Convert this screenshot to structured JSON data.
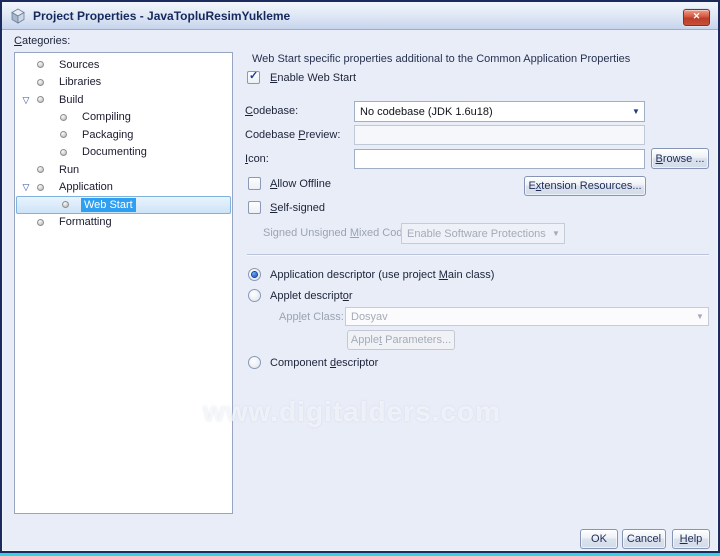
{
  "window": {
    "title": "Project Properties - JavaTopluResimYukleme"
  },
  "icons": {
    "close": "✕",
    "dropdown": "▼",
    "expanded": "▽",
    "check": "✓"
  },
  "categories": {
    "label": {
      "text": "Categories:",
      "m": 0
    },
    "items": [
      {
        "label": "Sources",
        "level": 1
      },
      {
        "label": "Libraries",
        "level": 1
      },
      {
        "label": "Build",
        "level": 1,
        "expanded": true
      },
      {
        "label": "Compiling",
        "level": 2
      },
      {
        "label": "Packaging",
        "level": 2
      },
      {
        "label": "Documenting",
        "level": 2
      },
      {
        "label": "Run",
        "level": 1
      },
      {
        "label": "Application",
        "level": 1,
        "expanded": true
      },
      {
        "label": "Web Start",
        "level": 2,
        "selected": true
      },
      {
        "label": "Formatting",
        "level": 1
      }
    ]
  },
  "panel": {
    "header": "Web Start specific properties additional to the Common Application Properties",
    "enable_web_start": {
      "text": "Enable Web Start",
      "m": 0,
      "checked": true
    },
    "codebase_label": {
      "text": "Codebase:",
      "m": 0
    },
    "codebase_value": "No codebase (JDK 1.6u18)",
    "codebase_preview_label": {
      "text": "Codebase Preview:",
      "m": 9
    },
    "codebase_preview_value": "",
    "icon_label": {
      "text": "Icon:",
      "m": 0
    },
    "icon_value": "",
    "browse_button": {
      "text": "Browse ...",
      "m": 0
    },
    "allow_offline": {
      "text": "Allow Offline",
      "m": 0,
      "checked": false
    },
    "extension_resources_button": {
      "text": "Extension Resources...",
      "m": 1
    },
    "self_signed": {
      "text": "Self-signed",
      "m": 0,
      "checked": false
    },
    "mixed_code_label": {
      "text": "Signed Unsigned Mixed Code:",
      "m": 16
    },
    "mixed_code_value": "Enable Software Protections",
    "radio_application": {
      "text": "Application descriptor (use project Main class)",
      "m": 36,
      "selected": true
    },
    "radio_applet": {
      "text": "Applet descriptor",
      "m": 15,
      "selected": false
    },
    "applet_class_label": {
      "text": "Applet Class:",
      "m": 3
    },
    "applet_class_value": "Dosyav",
    "applet_parameters_button": {
      "text": "Applet Parameters...",
      "m": 5
    },
    "radio_component": {
      "text": "Component descriptor",
      "m": 10,
      "selected": false
    }
  },
  "watermark": "www.digitalders.com",
  "footer": {
    "ok": "OK",
    "cancel": "Cancel",
    "help": {
      "text": "Help",
      "m": 0
    }
  },
  "colors": {
    "titlebar_top": "#f3f7fc",
    "titlebar_bottom": "#c6d4ec",
    "dialog_bg": "#e9edf8",
    "window_border": "#1c2b5e",
    "bottom_strip": "#2fd5e2",
    "selection_blue": "#2f9ff2",
    "selection_row_bg": "#cde3f6",
    "close_button_red": "#c8503a",
    "text": "#1c2338",
    "disabled_text": "#9ba3b3",
    "title_text": "#16295e"
  }
}
